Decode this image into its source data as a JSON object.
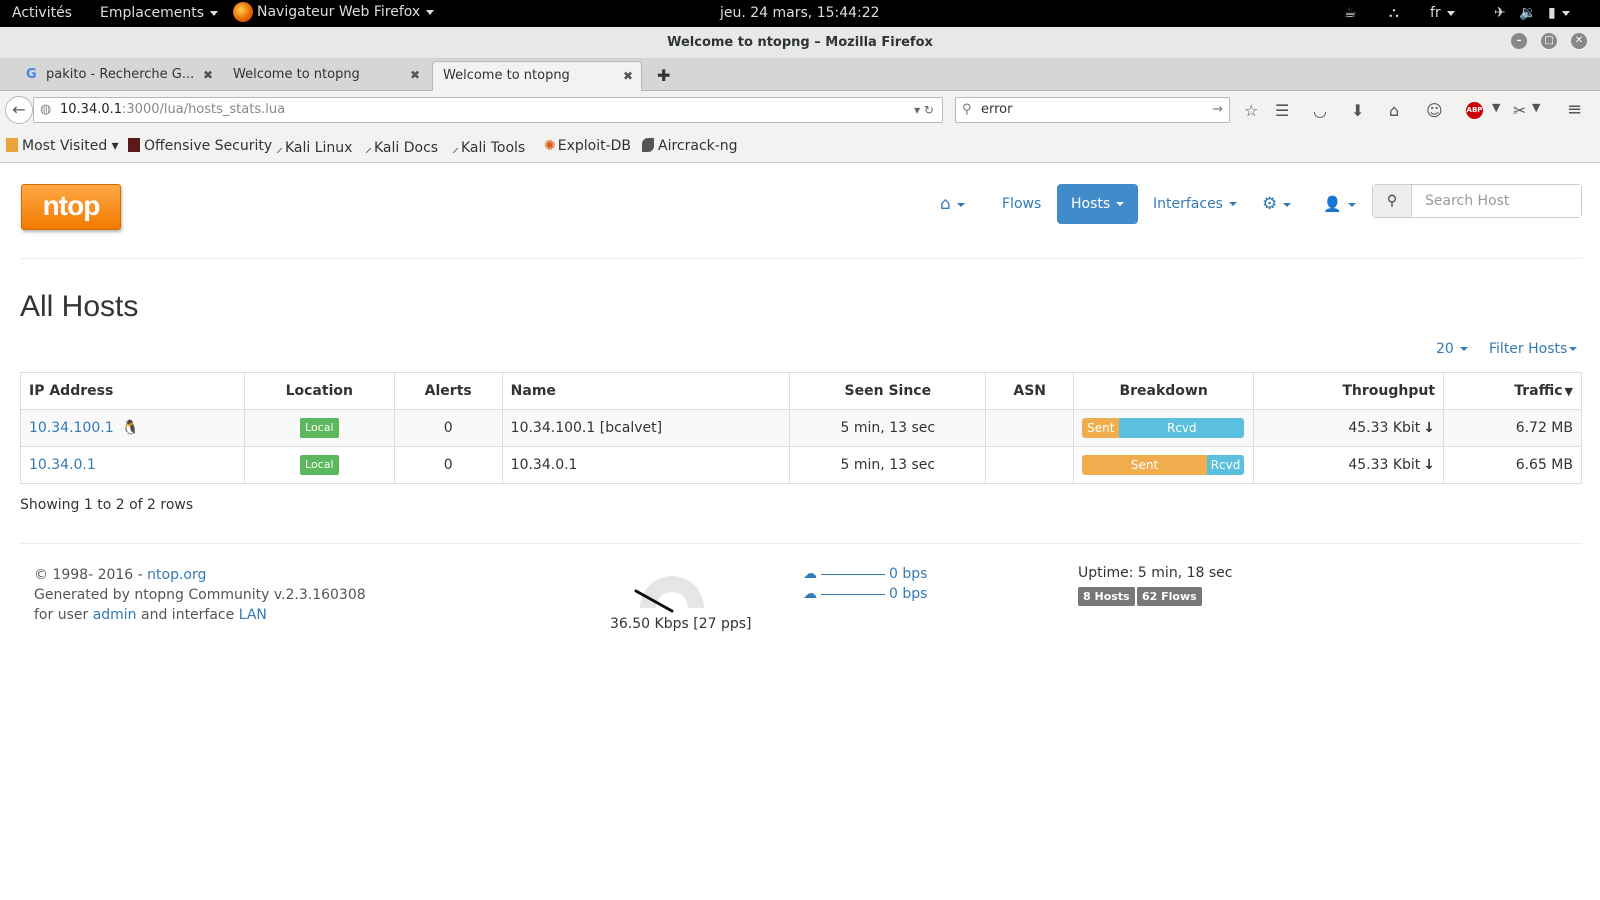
{
  "gnome": {
    "activities": "Activités",
    "places": "Emplacements",
    "app": "Navigateur Web Firefox",
    "clock": "jeu. 24 mars, 15:44:22",
    "lang": "fr"
  },
  "window": {
    "title": "Welcome to ntopng – Mozilla Firefox"
  },
  "tabs": [
    {
      "label": "pakito - Recherche G..."
    },
    {
      "label": "Welcome to ntopng"
    },
    {
      "label": "Welcome to ntopng"
    }
  ],
  "urlbar": {
    "host": "10.34.0.1",
    "path": ":3000/lua/hosts_stats.lua"
  },
  "searchbar": {
    "value": "error"
  },
  "bookmarks": [
    "Most Visited",
    "Offensive Security",
    "Kali Linux",
    "Kali Docs",
    "Kali Tools",
    "Exploit-DB",
    "Aircrack-ng"
  ],
  "ntop": {
    "logo": "ntop",
    "nav": {
      "flows": "Flows",
      "hosts": "Hosts",
      "interfaces": "Interfaces"
    },
    "search_placeholder": "Search Host",
    "page_title": "All Hosts",
    "page_size": "20",
    "filter": "Filter Hosts",
    "columns": [
      "IP Address",
      "Location",
      "Alerts",
      "Name",
      "Seen Since",
      "ASN",
      "Breakdown",
      "Throughput",
      "Traffic"
    ],
    "rows": [
      {
        "ip": "10.34.100.1",
        "location": "Local",
        "alerts": "0",
        "name": "10.34.100.1 [bcalvet]",
        "seen": "5 min, 13 sec",
        "asn": "",
        "sent_label": "Sent",
        "rcvd_label": "Rcvd",
        "sent_pct": 23,
        "throughput": "45.33 Kbit",
        "traffic": "6.72 MB"
      },
      {
        "ip": "10.34.0.1",
        "location": "Local",
        "alerts": "0",
        "name": "10.34.0.1",
        "seen": "5 min, 13 sec",
        "asn": "",
        "sent_label": "Sent",
        "rcvd_label": "Rcvd",
        "sent_pct": 77,
        "throughput": "45.33 Kbit",
        "traffic": "6.65 MB"
      }
    ],
    "rows_info": "Showing 1 to 2 of 2 rows",
    "footer": {
      "copyright": "© 1998- 2016 - ",
      "ntop_link": "ntop.org",
      "generated": "Generated by ntopng Community v.2.3.160308",
      "for_user": "for user ",
      "user": "admin",
      "and_iface": " and interface ",
      "iface": "LAN",
      "gauge_value": "36.50 Kbps [27 pps]",
      "upload_bps": "0 bps",
      "download_bps": "0 bps",
      "uptime": "Uptime: 5 min, 18 sec",
      "hosts_badge": "8 Hosts",
      "flows_badge": "62 Flows"
    }
  },
  "colors": {
    "link": "#337ab7",
    "active_nav": "#428bca",
    "sent": "#f0ad4e",
    "rcvd": "#5bc0de",
    "local": "#5cb85c",
    "logo": "#f27a00"
  }
}
